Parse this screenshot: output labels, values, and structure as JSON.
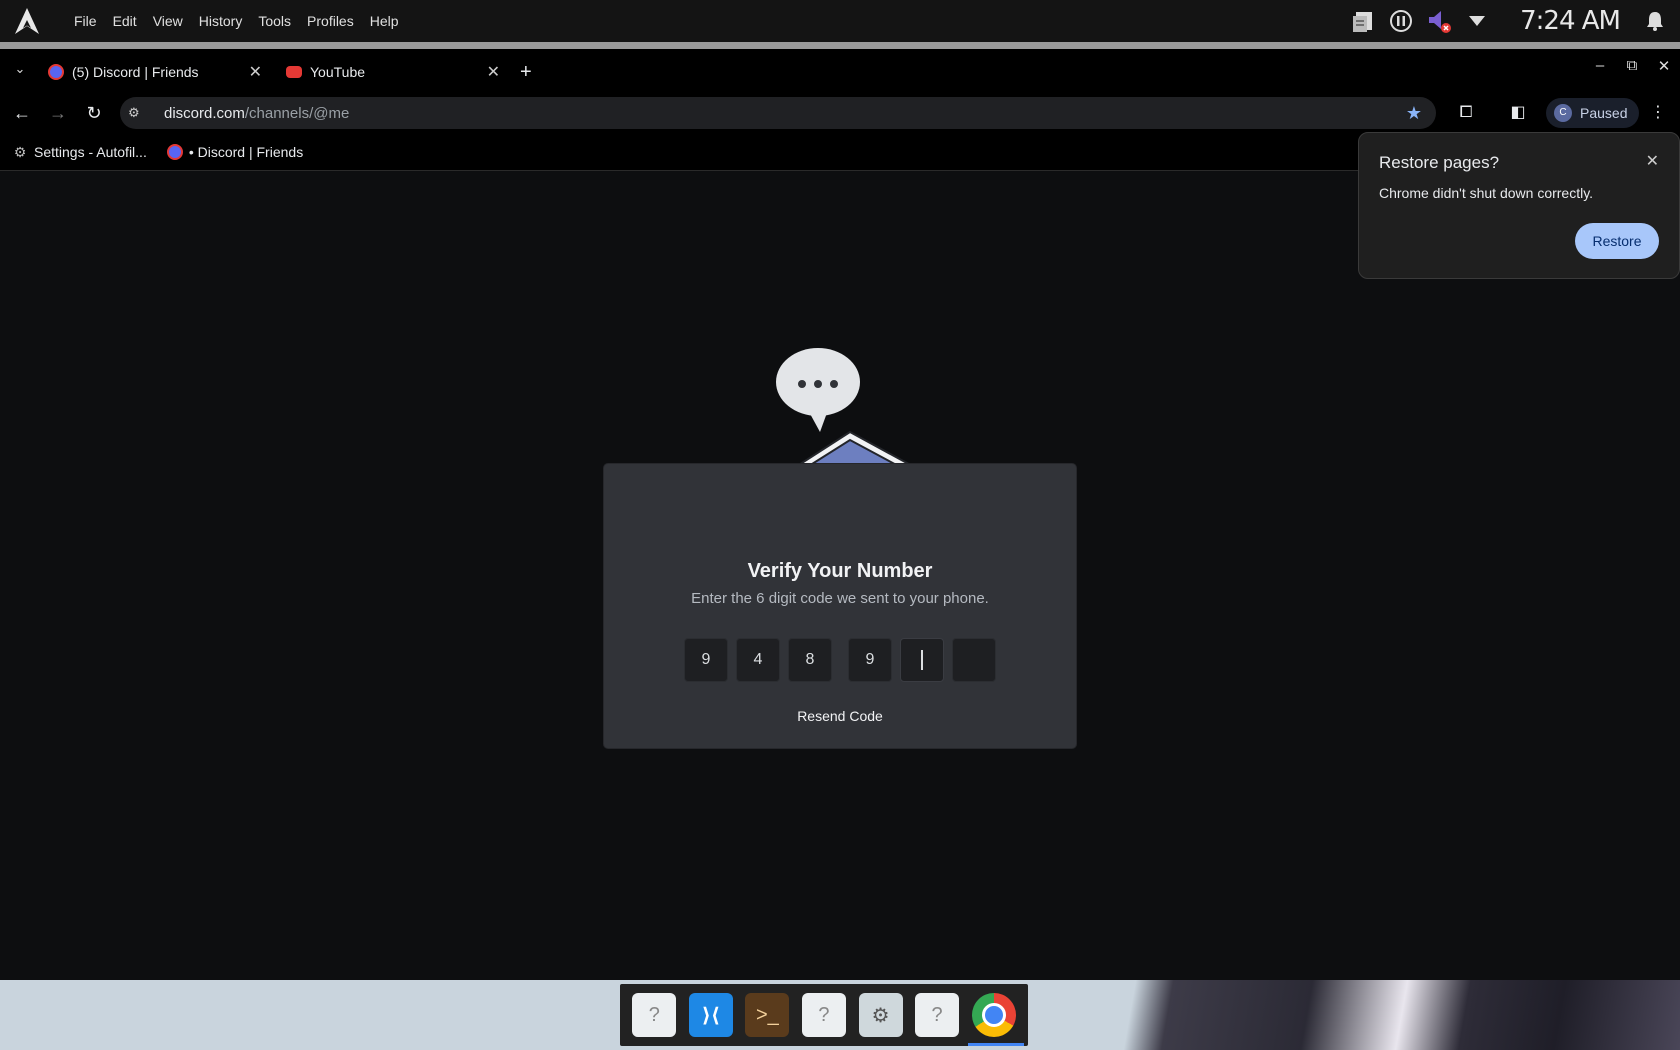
{
  "system_menu": {
    "items": [
      "File",
      "Edit",
      "View",
      "History",
      "Tools",
      "Profiles",
      "Help"
    ],
    "clock": "7:24 AM",
    "tray_icons": [
      "clipboard-icon",
      "pause-icon",
      "volume-muted-icon",
      "chevron-down-icon",
      "bell-icon"
    ]
  },
  "tabs": [
    {
      "title": "(5) Discord | Friends",
      "favicon": "discord-icon"
    },
    {
      "title": "YouTube",
      "favicon": "youtube-icon"
    }
  ],
  "address_bar": {
    "domain": "discord.com",
    "path": "/channels/@me"
  },
  "profile": {
    "initial": "C",
    "status": "Paused"
  },
  "bookmarks": [
    {
      "label": "Settings - Autofil...",
      "icon": "gear-icon"
    },
    {
      "label": "• Discord | Friends",
      "icon": "discord-icon"
    }
  ],
  "modal": {
    "title": "Verify Your Number",
    "subtitle": "Enter the 6 digit code we sent to your phone.",
    "code_digits": [
      "9",
      "4",
      "8",
      "9",
      "",
      ""
    ],
    "resend_label": "Resend Code"
  },
  "restore_popup": {
    "title": "Restore pages?",
    "body": "Chrome didn't shut down correctly.",
    "button": "Restore"
  },
  "dock": {
    "apps": [
      "unknown-file-icon",
      "vscode-icon",
      "terminal-icon",
      "unknown-file-icon",
      "settings-icon",
      "unknown-file-icon",
      "chrome-icon"
    ]
  },
  "colors": {
    "accent": "#8ab4f8",
    "restore_button": "#a8c7fa",
    "modal_bg": "#313338",
    "discord_blurple": "#5865f2"
  }
}
